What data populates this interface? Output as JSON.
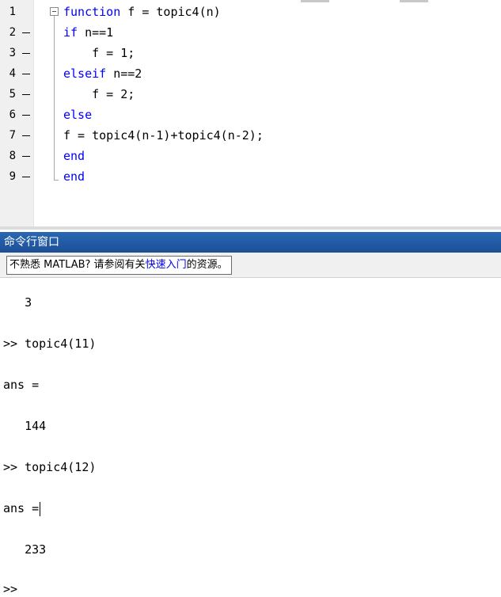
{
  "editor": {
    "lines": [
      {
        "num": "1",
        "kw": "function",
        "rest": " f = topic4(n)"
      },
      {
        "num": "2",
        "kw": "if",
        "rest": " n==1"
      },
      {
        "num": "3",
        "kw": "",
        "rest": "    f = 1;"
      },
      {
        "num": "4",
        "kw": "elseif",
        "rest": " n==2"
      },
      {
        "num": "5",
        "kw": "",
        "rest": "    f = 2;"
      },
      {
        "num": "6",
        "kw": "else",
        "rest": ""
      },
      {
        "num": "7",
        "kw": "",
        "rest": "f = topic4(n-1)+topic4(n-2);"
      },
      {
        "num": "8",
        "kw": "end",
        "rest": ""
      },
      {
        "num": "9",
        "kw": "end",
        "rest": ""
      }
    ]
  },
  "command_window": {
    "title": "命令行窗口",
    "notice": {
      "before": "不熟悉 MATLAB? 请参阅有关",
      "link": "快速入门",
      "after": "的资源。"
    },
    "output": {
      "value_3": "   3",
      "prompt_11": ">> topic4(11)",
      "ans_1": "ans =",
      "value_144": "   144",
      "prompt_12": ">> topic4(12)",
      "ans_2": "ans =",
      "value_233": "   233",
      "prompt_empty": ">>"
    }
  },
  "colors": {
    "keyword": "#0000ff",
    "titlebar": "#1d4f96",
    "link": "#0000ee"
  }
}
